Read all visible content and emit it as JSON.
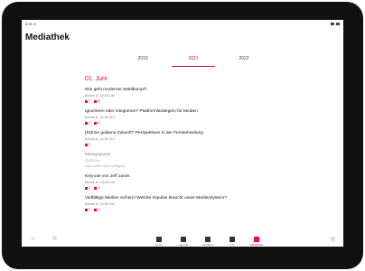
{
  "status": {
    "left": "5:00 ⊙"
  },
  "app": {
    "title": "Mediathek"
  },
  "tabs": [
    "2019",
    "2021",
    "2022"
  ],
  "active_tab": "2021",
  "date_heading": "01. Juni",
  "sessions": [
    {
      "title": "Wie geht moderner Wahlkampf?",
      "meta": "Bühne A, 10:00 Uhr",
      "tags": [
        "7",
        "4"
      ]
    },
    {
      "title": "Ignorieren oder integrieren? Plattformstrategien für Medien",
      "meta": "Bühne A, 11:30 Uhr",
      "tags": [
        "7",
        "5"
      ]
    },
    {
      "title": "(K)Eine goldene Zukunft? Perspektiven in der Fernsehwelung",
      "meta": "Bühne A, 11:30 Uhr",
      "tags": [
        "7"
      ]
    },
    {
      "title": "Mittagspause",
      "meta": "13:30 Uhr",
      "note": "kann leider nicht verfügbar",
      "muted": true
    },
    {
      "title": "Keynote von Jeff Jarvis",
      "meta": "Bühne A, 13:30 Uhr",
      "tags": [
        "7",
        "3"
      ]
    },
    {
      "title": "Vielfältige Medien sichern! Welche Impulse braucht unser Mediensystem?",
      "meta": "Bühne A, 14:30 Uhr",
      "tags": [
        "7",
        "3"
      ]
    }
  ],
  "nav": [
    {
      "label": "Home",
      "icon": "home-icon"
    },
    {
      "label": "Agenda",
      "icon": "agenda-icon"
    },
    {
      "label": "Speakers",
      "icon": "speakers-icon"
    },
    {
      "label": "Info",
      "icon": "info-icon"
    },
    {
      "label": "Mediathek",
      "icon": "mediathek-icon",
      "active": true
    }
  ]
}
